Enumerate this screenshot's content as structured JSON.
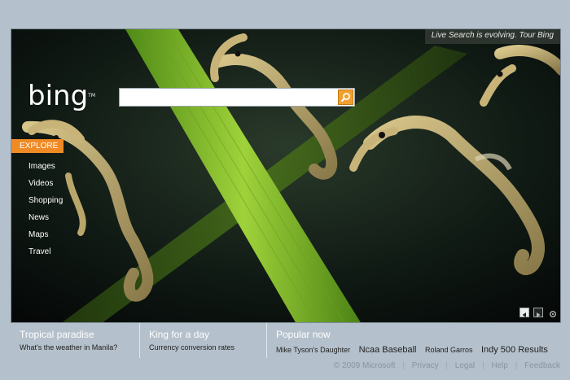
{
  "page": {
    "brand": "bing",
    "trademark": "TM"
  },
  "search": {
    "value": "",
    "placeholder": ""
  },
  "tour": {
    "text": "Live Search is evolving. Tour Bing"
  },
  "explore": {
    "label": "EXPLORE",
    "items": [
      {
        "label": "Images"
      },
      {
        "label": "Videos"
      },
      {
        "label": "Shopping"
      },
      {
        "label": "News"
      },
      {
        "label": "Maps"
      },
      {
        "label": "Travel"
      }
    ]
  },
  "strip": {
    "col1": {
      "title": "Tropical paradise",
      "link": "What's the weather in Manila?"
    },
    "col2": {
      "title": "King for a day",
      "link": "Currency conversion rates"
    },
    "col3": {
      "title": "Popular now",
      "items": [
        {
          "label": "Mike Tyson's Daughter"
        },
        {
          "label": "Ncaa Baseball"
        },
        {
          "label": "Roland Garros"
        },
        {
          "label": "Indy 500 Results"
        }
      ]
    }
  },
  "footer": {
    "copyright": "© 2009 Microsoft",
    "links": [
      {
        "label": "Privacy"
      },
      {
        "label": "Legal"
      },
      {
        "label": "Help"
      },
      {
        "label": "Feedback"
      }
    ],
    "separator": "|"
  },
  "icons": {
    "search": "search-icon",
    "prev": "previous-image-icon",
    "next": "next-image-icon",
    "info": "info-icon"
  },
  "colors": {
    "accent": "#f08a24",
    "background": "#b4c0cb"
  }
}
